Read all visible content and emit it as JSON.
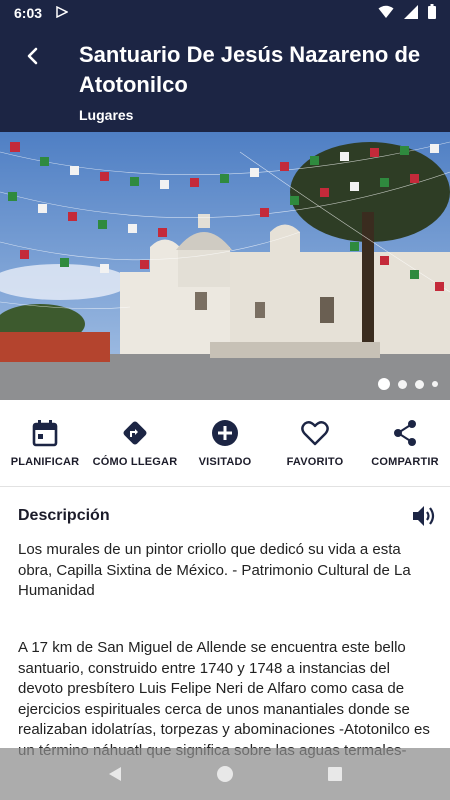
{
  "status": {
    "time": "6:03",
    "play_icon": "play-store-icon",
    "wifi_icon": "wifi-icon",
    "signal_icon": "signal-icon",
    "battery_icon": "battery-icon"
  },
  "header": {
    "back_icon": "back-arrow-icon",
    "title": "Santuario De Jesús Nazareno de Atotonilco",
    "subtitle": "Lugares"
  },
  "gallery": {
    "image": "church-photo",
    "pages": 4,
    "current_page": 1
  },
  "actions": [
    {
      "label": "PLANIFICAR",
      "icon": "calendar-icon"
    },
    {
      "label": "CÓMO LLEGAR",
      "icon": "directions-icon"
    },
    {
      "label": "VISITADO",
      "icon": "plus-circle-icon"
    },
    {
      "label": "FAVORITO",
      "icon": "heart-icon"
    },
    {
      "label": "COMPARTIR",
      "icon": "share-icon"
    }
  ],
  "description": {
    "title": "Descripción",
    "speaker_icon": "speaker-icon",
    "paragraph1": "Los murales de un pintor criollo que dedicó su vida a esta obra, Capilla Sixtina de México. - Patrimonio Cultural de La Humanidad",
    "paragraph2": "A 17 km de San Miguel de Allende se encuentra este bello santuario, construido entre 1740 y 1748 a instancias del devoto presbítero Luis Felipe Neri de Alfaro como casa de ejercicios espirituales cerca de unos manantiales donde se realizaban idolatrías, torpezas y abominaciones -Atotonilco es un término náhuatl que significa sobre las aguas termales-"
  },
  "navbar": {
    "back": "nav-back-icon",
    "home": "nav-home-icon",
    "recents": "nav-recents-icon"
  },
  "colors": {
    "primary": "#1c2544",
    "text": "#1c1c2a"
  }
}
